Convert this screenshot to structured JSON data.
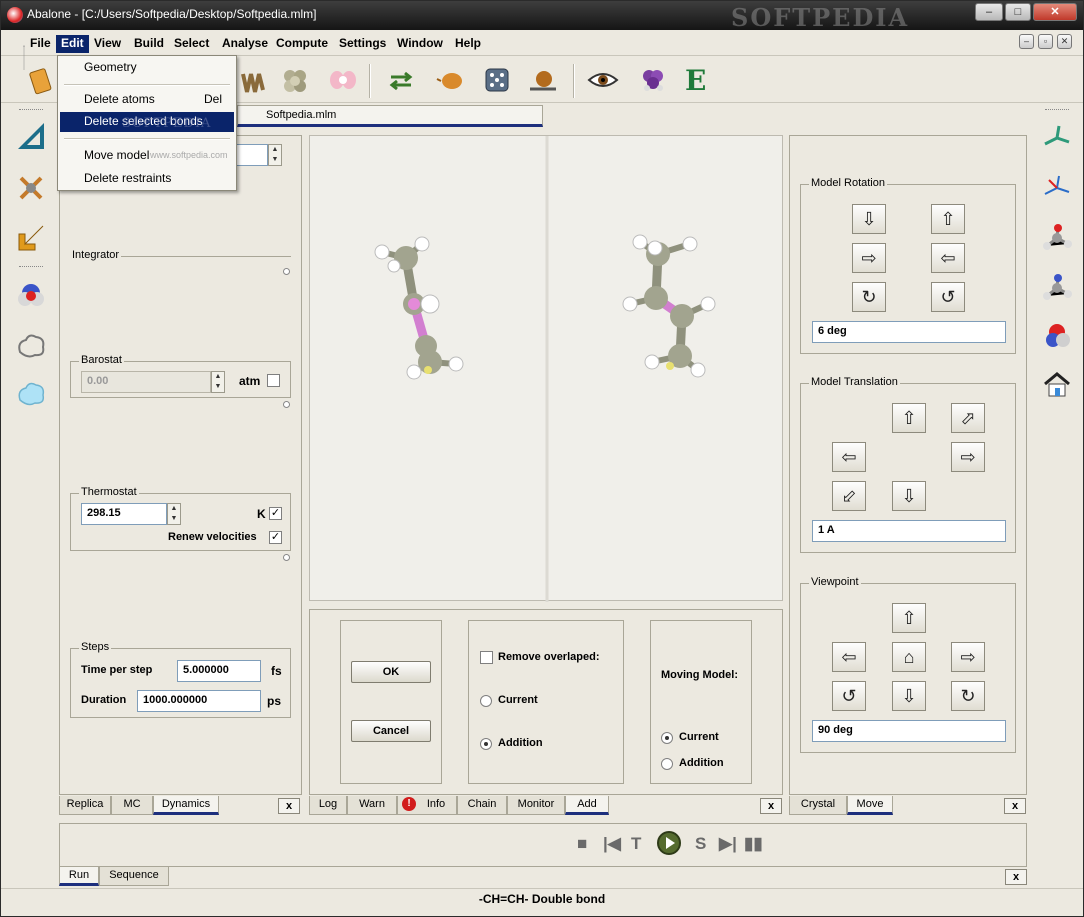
{
  "window": {
    "title": "Abalone - [C:/Users/Softpedia/Desktop/Softpedia.mlm]",
    "watermark": "SOFTPEDIA",
    "controls": {
      "minimize": "–",
      "maximize": "□",
      "close": "✕"
    }
  },
  "menubar": {
    "items": [
      "File",
      "Edit",
      "View",
      "Build",
      "Select",
      "Analyse",
      "Compute",
      "Settings",
      "Window",
      "Help"
    ],
    "active": "Edit"
  },
  "edit_menu": {
    "items": [
      {
        "label": "Geometry",
        "shortcut": ""
      },
      {
        "label": "Delete atoms",
        "shortcut": "Del"
      },
      {
        "label": "Delete selected bonds",
        "shortcut": ""
      },
      {
        "label": "Move model",
        "shortcut": ""
      },
      {
        "label": "Delete restraints",
        "shortcut": ""
      }
    ],
    "highlighted": "Delete selected bonds",
    "overlay_text": "SOFTPEDIA",
    "overlay_url": "www.softpedia.com"
  },
  "toolbar_icons": [
    "book-icon",
    "hand-icon",
    "atom-cluster-icon",
    "orbital-icon",
    "exchange-arrows-icon",
    "shell-icon",
    "dice-icon",
    "snail-icon",
    "eye-icon",
    "grape-molecule-icon",
    "e-letter-icon"
  ],
  "toolbar_letter": "E",
  "document_tab": "Softpedia.mlm",
  "left_panel": {
    "integrator_label": "Integrator",
    "barostat": {
      "label": "Barostat",
      "value": "0.00",
      "unit": "atm"
    },
    "thermostat": {
      "label": "Thermostat",
      "value": "298.15",
      "unit": "K",
      "renew_label": "Renew velocities",
      "unit_checked": "✓",
      "renew_checked": "✓"
    },
    "steps": {
      "label": "Steps",
      "time_label": "Time per step",
      "time_value": "5.000000",
      "time_unit": "fs",
      "duration_label": "Duration",
      "duration_value": "1000.000000",
      "duration_unit": "ps"
    },
    "tabs": [
      "Replica",
      "MC",
      "Dynamics"
    ],
    "selected_tab": "Dynamics"
  },
  "add_panel": {
    "ok_label": "OK",
    "cancel_label": "Cancel",
    "remove_overlap_label": "Remove overlaped:",
    "current_label": "Current",
    "addition_label": "Addition",
    "moving_model_label": "Moving Model:",
    "moving_current_label": "Current",
    "moving_addition_label": "Addition",
    "tabs": [
      "Log",
      "Warn",
      "Info",
      "Chain",
      "Monitor",
      "Add"
    ],
    "selected_tab": "Add",
    "info_badge": "!"
  },
  "right_panel": {
    "rotation": {
      "label": "Model Rotation",
      "value": "6 deg"
    },
    "translation": {
      "label": "Model Translation",
      "value": "1 A"
    },
    "viewpoint": {
      "label": "Viewpoint",
      "value": "90 deg"
    },
    "tabs": [
      "Crystal",
      "Move"
    ],
    "selected_tab": "Move"
  },
  "run_bar": {
    "tabs": [
      "Run",
      "Sequence"
    ],
    "selected_tab": "Run",
    "controls": [
      "■",
      "|◀",
      "T",
      "▶",
      "S",
      "▶|",
      "▮▮"
    ]
  },
  "close_label": "x",
  "status": "-CH=CH- Double bond",
  "colors": {
    "accent": "#0a246a",
    "tab_underline": "#1d2f7d",
    "carbon": "#9a9c88",
    "hydrogen": "#ffffff",
    "double_bond": "#e48ad8"
  }
}
